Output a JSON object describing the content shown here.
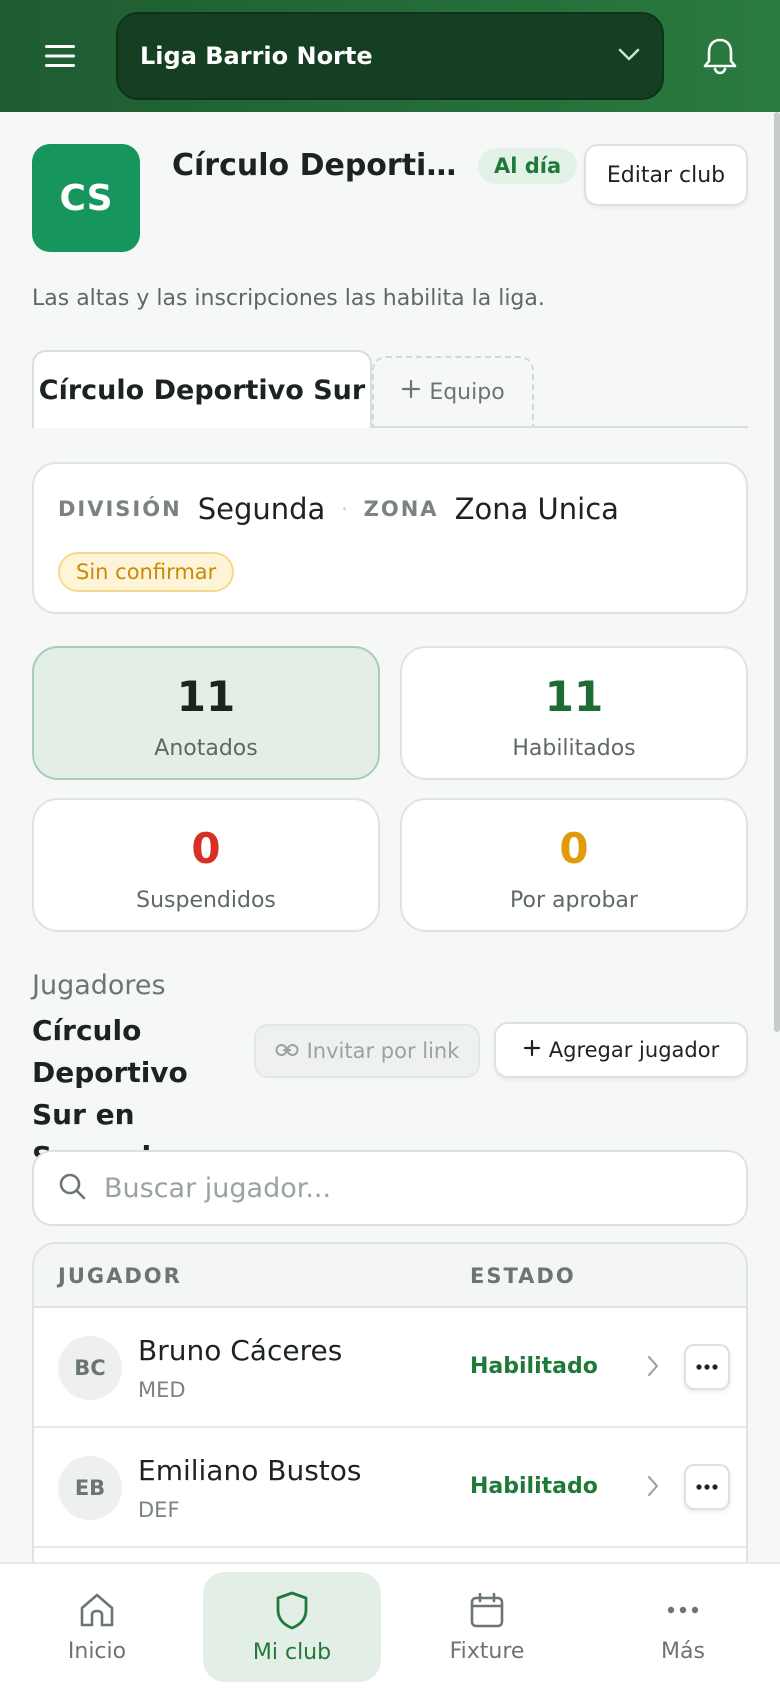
{
  "header": {
    "league_name": "Liga Barrio Norte",
    "menu_icon": "hamburger-menu-icon",
    "bell_icon": "bell-icon"
  },
  "club": {
    "initials": "CS",
    "name": "Círculo Deportivo Sur",
    "status": "Al día",
    "edit_label": "Editar club",
    "note": "Las altas y las inscripciones las habilita la liga."
  },
  "tabs": {
    "active_label": "Círculo Deportivo Sur",
    "add_label": "Equipo"
  },
  "division": {
    "division_label": "DIVISIÓN",
    "division_value": "Segunda",
    "zone_label": "ZONA",
    "zone_value": "Zona Unica",
    "badge": "Sin confirmar"
  },
  "stats": [
    {
      "value": "11",
      "label": "Anotados",
      "color": "#1d2420"
    },
    {
      "value": "11",
      "label": "Habilitados",
      "color": "#1f6b35"
    },
    {
      "value": "0",
      "label": "Suspendidos",
      "color": "#d93025"
    },
    {
      "value": "0",
      "label": "Por aprobar",
      "color": "#e09a0b"
    }
  ],
  "players": {
    "kicker": "Jugadores",
    "title": "Círculo Deportivo Sur en Segunda",
    "invite_label": "Invitar por link",
    "add_label": "Agregar jugador",
    "search_placeholder": "Buscar jugador...",
    "col_player": "JUGADOR",
    "col_state": "ESTADO",
    "rows": [
      {
        "initials": "BC",
        "name": "Bruno Cáceres",
        "position": "MED",
        "state": "Habilitado"
      },
      {
        "initials": "EB",
        "name": "Emiliano Bustos",
        "position": "DEF",
        "state": "Habilitado"
      },
      {
        "initials": "",
        "name": "",
        "position": "",
        "state": ""
      }
    ]
  },
  "nav": [
    {
      "label": "Inicio",
      "icon": "home-icon"
    },
    {
      "label": "Mi club",
      "icon": "shield-icon"
    },
    {
      "label": "Fixture",
      "icon": "calendar-icon"
    },
    {
      "label": "Más",
      "icon": "more-icon"
    }
  ],
  "colors": {
    "brand_green": "#2a7a3f",
    "accent_green": "#1f7a3a",
    "danger": "#d93025",
    "warning": "#e09a0b"
  }
}
